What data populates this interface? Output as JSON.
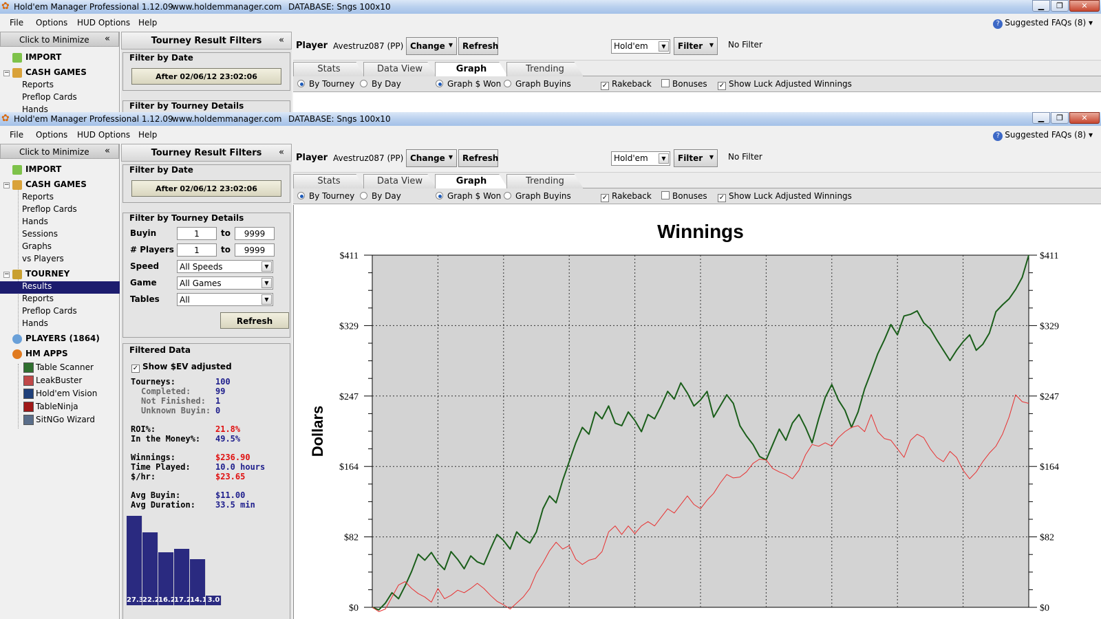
{
  "app": {
    "title": "Hold'em Manager Professional 1.12.09",
    "url": "www.holdemmanager.com",
    "database": "DATABASE: Sngs 100x10"
  },
  "menu": {
    "file": "File",
    "options": "Options",
    "hud": "HUD Options",
    "help": "Help",
    "faq": "Suggested FAQs (8)"
  },
  "nav": {
    "minimize": "Click to Minimize",
    "import": "IMPORT",
    "cash": "CASH GAMES",
    "cash_items": [
      "Reports",
      "Preflop Cards",
      "Hands",
      "Sessions",
      "Graphs",
      "vs Players"
    ],
    "tourney": "TOURNEY",
    "tourney_items": [
      "Results",
      "Reports",
      "Preflop Cards",
      "Hands"
    ],
    "players": "PLAYERS (1864)",
    "hmapps": "HM APPS",
    "apps": [
      "Table Scanner",
      "LeakBuster",
      "Hold'em Vision",
      "TableNinja",
      "SitNGo Wizard"
    ]
  },
  "filters": {
    "title": "Tourney Result Filters",
    "by_date": "Filter by Date",
    "date_button": "After 02/06/12 23:02:06",
    "by_details": "Filter by Tourney Details",
    "buyin_label": "Buyin",
    "buyin_from": "1",
    "buyin_to": "9999",
    "players_label": "# Players",
    "players_from": "1",
    "players_to": "9999",
    "to": "to",
    "speed_label": "Speed",
    "speed": "All Speeds",
    "game_label": "Game",
    "game": "All Games",
    "tables_label": "Tables",
    "tables": "All",
    "refresh": "Refresh",
    "filtered_data": "Filtered Data",
    "show_ev": "Show $EV adjusted"
  },
  "stats": {
    "tourneys_l": "Tourneys:",
    "tourneys": "100",
    "completed_l": "Completed:",
    "completed": "99",
    "notfinished_l": "Not Finished:",
    "notfinished": "1",
    "unknown_l": "Unknown Buyin:",
    "unknown": "0",
    "roi_l": "ROI%:",
    "roi": "21.8%",
    "itm_l": "In the Money%:",
    "itm": "49.5%",
    "win_l": "Winnings:",
    "win": "$236.90",
    "time_l": "Time Played:",
    "time": "10.0 hours",
    "hr_l": "$/hr:",
    "hr": "$23.65",
    "avgbuy_l": "Avg Buyin:",
    "avgbuy": "$11.00",
    "avgdur_l": "Avg Duration:",
    "avgdur": "33.5 min"
  },
  "finish_bars": [
    {
      "label": "27.3",
      "value": 27.3
    },
    {
      "label": "22.2",
      "value": 22.2
    },
    {
      "label": "16.2",
      "value": 16.2
    },
    {
      "label": "17.2",
      "value": 17.2
    },
    {
      "label": "14.1",
      "value": 14.1
    },
    {
      "label": "3.0",
      "value": 3.0
    }
  ],
  "player": {
    "label": "Player",
    "name": "Avestruz087 (PP)",
    "change": "Change",
    "refresh": "Refresh",
    "game": "Hold'em",
    "filter": "Filter",
    "no_filter": "No Filter"
  },
  "tabs": [
    "Stats",
    "Data View",
    "Graph",
    "Trending"
  ],
  "options": {
    "by_tourney": "By Tourney",
    "by_day": "By Day",
    "graph_won": "Graph $ Won",
    "graph_buyins": "Graph Buyins",
    "rakeback": "Rakeback",
    "bonuses": "Bonuses",
    "luck": "Show Luck Adjusted Winnings"
  },
  "colors": {
    "winnings": "#1a5e1a",
    "luck_adjusted": "#e83030",
    "selected": "#1c1c6e"
  },
  "chart_data": {
    "type": "line",
    "title": "Winnings",
    "ylabel": "Dollars",
    "xlabel": "",
    "yticks": [
      "$0",
      "$82",
      "$164",
      "$247",
      "$329",
      "$411"
    ],
    "ylim": [
      0,
      411
    ],
    "xlim": [
      0,
      100
    ],
    "grid": true,
    "series": [
      {
        "values": [
          0,
          -3,
          5,
          17,
          10,
          25,
          42,
          62,
          55,
          64,
          52,
          44,
          65,
          56,
          45,
          60,
          53,
          50,
          68,
          85,
          78,
          68,
          88,
          80,
          75,
          88,
          115,
          130,
          122,
          148,
          170,
          192,
          210,
          202,
          228,
          220,
          235,
          215,
          212,
          228,
          218,
          205,
          225,
          220,
          235,
          252,
          243,
          262,
          250,
          235,
          242,
          252,
          222,
          235,
          248,
          238,
          212,
          200,
          190,
          176,
          172,
          190,
          208,
          195,
          215,
          225,
          210,
          192,
          220,
          245,
          260,
          242,
          230,
          210,
          228,
          255,
          275,
          296,
          312,
          330,
          318,
          340,
          342,
          346,
          332,
          325,
          312,
          300,
          288,
          300,
          310,
          318,
          300,
          307,
          320,
          345,
          353,
          360,
          371,
          385,
          411
        ]
      },
      {
        "values": [
          0,
          -5,
          -2,
          12,
          26,
          30,
          22,
          16,
          12,
          6,
          22,
          10,
          14,
          20,
          17,
          22,
          28,
          22,
          14,
          7,
          3,
          -2,
          5,
          12,
          22,
          40,
          52,
          66,
          76,
          68,
          72,
          56,
          50,
          55,
          57,
          65,
          88,
          95,
          85,
          95,
          86,
          95,
          100,
          95,
          105,
          115,
          110,
          120,
          130,
          120,
          115,
          125,
          133,
          145,
          155,
          151,
          152,
          158,
          168,
          173,
          172,
          162,
          158,
          155,
          150,
          160,
          178,
          190,
          188,
          192,
          188,
          198,
          205,
          210,
          212,
          205,
          225,
          205,
          197,
          195,
          185,
          175,
          195,
          202,
          198,
          185,
          175,
          170,
          182,
          175,
          160,
          150,
          158,
          170,
          180,
          188,
          202,
          222,
          248,
          240,
          238
        ]
      }
    ]
  }
}
